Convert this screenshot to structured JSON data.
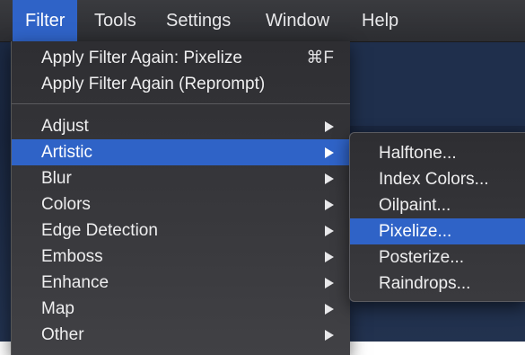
{
  "menubar": {
    "items": [
      {
        "label": "Filter",
        "active": true
      },
      {
        "label": "Tools"
      },
      {
        "label": "Settings"
      },
      {
        "label": "Window"
      },
      {
        "label": "Help"
      }
    ]
  },
  "filter_menu": {
    "top_items": [
      {
        "label": "Apply Filter Again: Pixelize",
        "shortcut": "⌘F"
      },
      {
        "label": "Apply Filter Again (Reprompt)",
        "shortcut": ""
      }
    ],
    "items": [
      {
        "label": "Adjust",
        "has_submenu": true
      },
      {
        "label": "Artistic",
        "has_submenu": true,
        "highlighted": true
      },
      {
        "label": "Blur",
        "has_submenu": true
      },
      {
        "label": "Colors",
        "has_submenu": true
      },
      {
        "label": "Edge Detection",
        "has_submenu": true
      },
      {
        "label": "Emboss",
        "has_submenu": true
      },
      {
        "label": "Enhance",
        "has_submenu": true
      },
      {
        "label": "Map",
        "has_submenu": true
      },
      {
        "label": "Other",
        "has_submenu": true
      }
    ]
  },
  "artistic_submenu": {
    "items": [
      {
        "label": "Halftone..."
      },
      {
        "label": "Index Colors..."
      },
      {
        "label": "Oilpaint..."
      },
      {
        "label": "Pixelize...",
        "highlighted": true
      },
      {
        "label": "Posterize..."
      },
      {
        "label": "Raindrops..."
      }
    ]
  },
  "colors": {
    "highlight": "#2f63c7",
    "menu_background": "#333337",
    "app_background": "#1c2a44"
  }
}
